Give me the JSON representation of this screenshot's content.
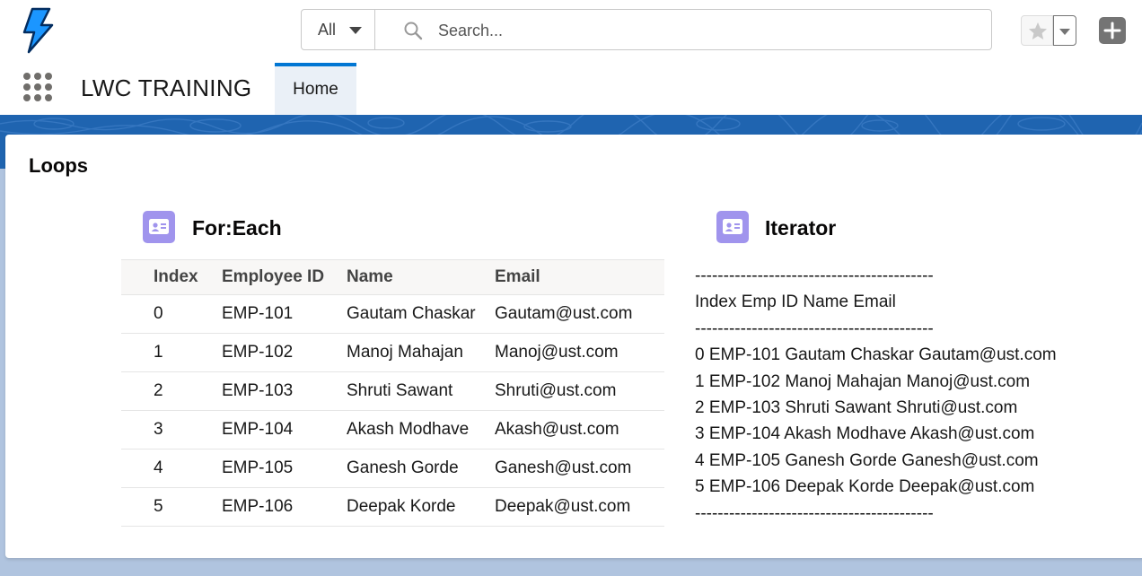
{
  "header": {
    "search": {
      "scope": "All",
      "placeholder": "Search..."
    }
  },
  "navbar": {
    "app_name": "LWC TRAINING",
    "tabs": [
      {
        "label": "Home",
        "active": true
      }
    ]
  },
  "card": {
    "title": "Loops",
    "for_each": {
      "title": "For:Each",
      "columns": [
        "Index",
        "Employee ID",
        "Name",
        "Email"
      ],
      "rows": [
        [
          "0",
          "EMP-101",
          "Gautam Chaskar",
          "Gautam@ust.com"
        ],
        [
          "1",
          "EMP-102",
          "Manoj Mahajan",
          "Manoj@ust.com"
        ],
        [
          "2",
          "EMP-103",
          "Shruti Sawant",
          "Shruti@ust.com"
        ],
        [
          "3",
          "EMP-104",
          "Akash Modhave",
          "Akash@ust.com"
        ],
        [
          "4",
          "EMP-105",
          "Ganesh Gorde",
          "Ganesh@ust.com"
        ],
        [
          "5",
          "EMP-106",
          "Deepak Korde",
          "Deepak@ust.com"
        ]
      ]
    },
    "iterator": {
      "title": "Iterator",
      "separator": "------------------------------------------",
      "header_line": "Index Emp ID Name Email",
      "lines": [
        "0 EMP-101 Gautam Chaskar Gautam@ust.com",
        "1 EMP-102 Manoj Mahajan Manoj@ust.com",
        "2 EMP-103 Shruti Sawant Shruti@ust.com",
        "3 EMP-104 Akash Modhave Akash@ust.com",
        "4 EMP-105 Ganesh Gorde Ganesh@ust.com",
        "5 EMP-106 Deepak Korde Deepak@ust.com"
      ]
    }
  },
  "colors": {
    "brand": "#0176d3",
    "banner": "#1f64b0",
    "section_icon": "#a094ed",
    "logo": "#1b96ff"
  },
  "icons": [
    "lightning-logo-icon",
    "chevron-down-icon",
    "search-icon",
    "star-icon",
    "plus-icon",
    "app-launcher-icon",
    "contact-card-icon"
  ]
}
